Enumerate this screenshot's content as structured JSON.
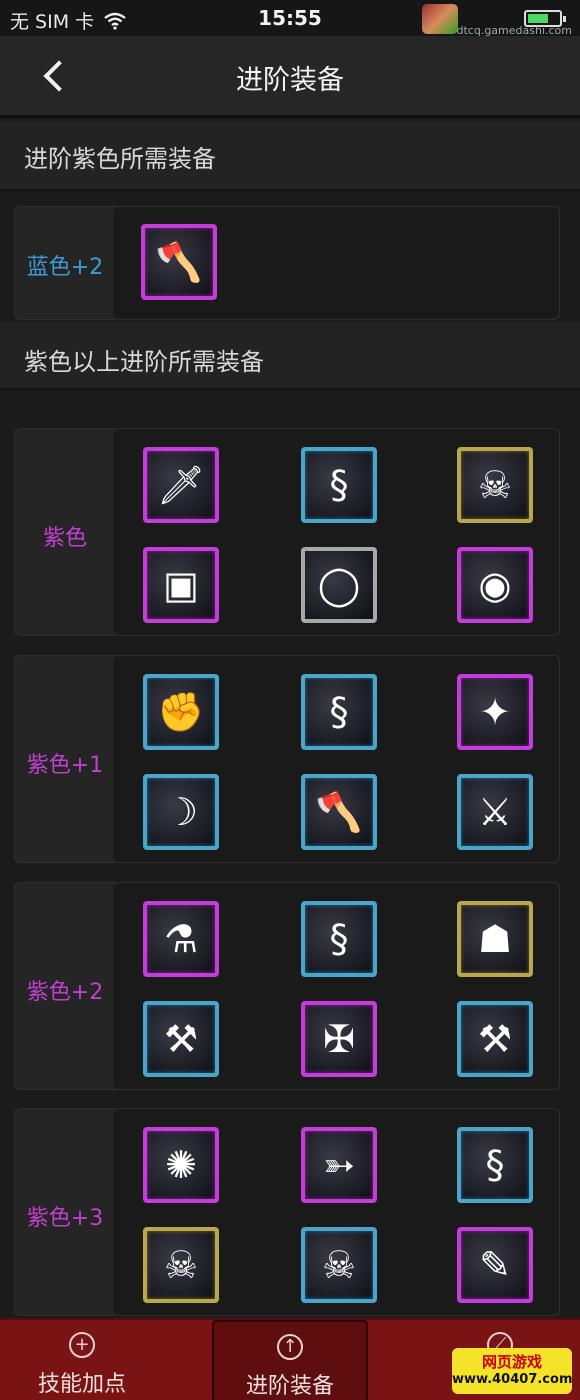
{
  "status_bar": {
    "carrier": "无 SIM 卡",
    "time": "15:55",
    "watermark": "dtcq.gamedashi.com"
  },
  "nav": {
    "title": "进阶装备"
  },
  "sections": {
    "advance_purple": "进阶紫色所需装备",
    "above_purple": "紫色以上进阶所需装备"
  },
  "groups": [
    {
      "label": "蓝色+2",
      "label_color": "#3b9bd8"
    },
    {
      "label": "紫色",
      "label_color": "#c23fd0"
    },
    {
      "label": "紫色+1",
      "label_color": "#c23fd0"
    },
    {
      "label": "紫色+2",
      "label_color": "#c23fd0"
    },
    {
      "label": "紫色+3",
      "label_color": "#c23fd0"
    }
  ],
  "items": {
    "g0": [
      {
        "icon": "axe-icon",
        "frame": "purple"
      }
    ],
    "g1": [
      {
        "icon": "dagger-icon",
        "frame": "purple"
      },
      {
        "icon": "cloak-icon",
        "frame": "blue"
      },
      {
        "icon": "shield-skull-icon",
        "frame": "gold"
      },
      {
        "icon": "armor-icon",
        "frame": "purple"
      },
      {
        "icon": "ring-icon",
        "frame": "grey"
      },
      {
        "icon": "orb-icon",
        "frame": "purple"
      }
    ],
    "g2": [
      {
        "icon": "gauntlet-icon",
        "frame": "blue"
      },
      {
        "icon": "cloak-icon",
        "frame": "blue"
      },
      {
        "icon": "green-blade-icon",
        "frame": "purple"
      },
      {
        "icon": "bloody-blade-icon",
        "frame": "blue"
      },
      {
        "icon": "axe-icon",
        "frame": "blue"
      },
      {
        "icon": "sword-icon",
        "frame": "blue"
      }
    ],
    "g3": [
      {
        "icon": "potion-icon",
        "frame": "purple"
      },
      {
        "icon": "cloak-icon",
        "frame": "blue"
      },
      {
        "icon": "hood-icon",
        "frame": "gold"
      },
      {
        "icon": "cleaver-icon",
        "frame": "blue"
      },
      {
        "icon": "dark-sword-icon",
        "frame": "purple"
      },
      {
        "icon": "hammer-icon",
        "frame": "blue"
      }
    ],
    "g4": [
      {
        "icon": "light-orb-icon",
        "frame": "purple"
      },
      {
        "icon": "crossbow-icon",
        "frame": "purple"
      },
      {
        "icon": "cloak-icon",
        "frame": "blue"
      },
      {
        "icon": "shield-skull-icon",
        "frame": "gold"
      },
      {
        "icon": "skull-staff-icon",
        "frame": "blue"
      },
      {
        "icon": "scroll-icon",
        "frame": "purple"
      }
    ]
  },
  "tabs": [
    {
      "label": "技能加点",
      "icon": "plus-circle-icon"
    },
    {
      "label": "进阶装备",
      "icon": "arrow-up-circle-icon",
      "active": true
    },
    {
      "label": "",
      "icon": "compass-icon"
    }
  ],
  "site_logo": {
    "line1": "网页游戏",
    "line2": "www.40407.com"
  }
}
